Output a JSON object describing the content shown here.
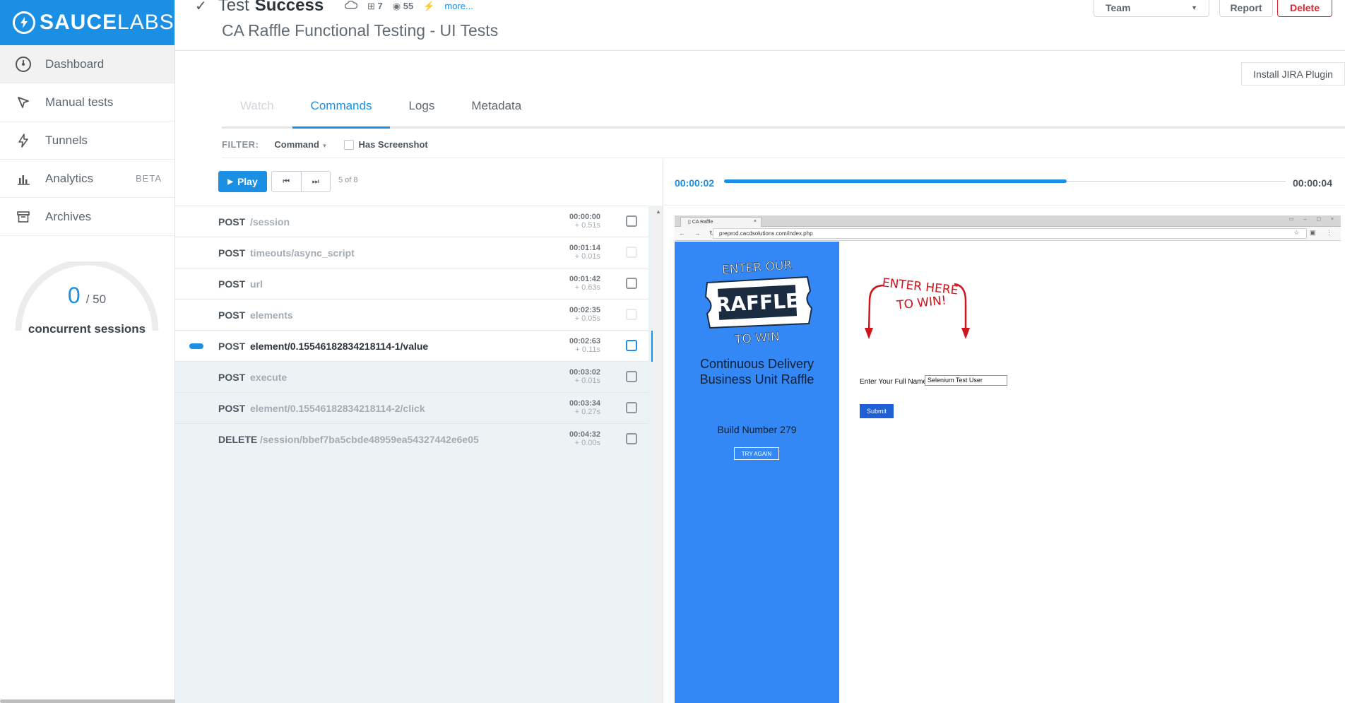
{
  "brand": {
    "name_bold": "SAUCE",
    "name_light": "LABS"
  },
  "sidebar": {
    "items": [
      {
        "label": "Dashboard",
        "icon": "gauge-icon"
      },
      {
        "label": "Manual tests",
        "icon": "cursor-icon"
      },
      {
        "label": "Tunnels",
        "icon": "bolt-icon"
      },
      {
        "label": "Analytics",
        "icon": "bar-chart-icon",
        "badge": "BETA"
      },
      {
        "label": "Archives",
        "icon": "archive-icon"
      }
    ],
    "sessions": {
      "current": "0",
      "max": "/ 50",
      "label": "concurrent sessions"
    }
  },
  "header": {
    "status_prefix": "Test",
    "status_word": "Success",
    "windows_version": "7",
    "chrome_version": "55",
    "more": "more...",
    "subtitle": "CA Raffle Functional Testing - UI Tests",
    "team_label": "Team",
    "report_label": "Report",
    "delete_label": "Delete"
  },
  "jira_button": "Install JIRA Plugin",
  "tabs": [
    {
      "label": "Watch",
      "state": "disabled"
    },
    {
      "label": "Commands",
      "state": "active"
    },
    {
      "label": "Logs",
      "state": "normal"
    },
    {
      "label": "Metadata",
      "state": "normal"
    }
  ],
  "filter": {
    "label": "FILTER:",
    "command": "Command",
    "screenshot_label": "Has Screenshot"
  },
  "player": {
    "play_label": "Play",
    "position": "5 of 8",
    "current_time": "00:00:02",
    "end_time": "00:00:04",
    "progress": 0.61
  },
  "commands": [
    {
      "method": "POST",
      "path": "/session",
      "time": "00:00:00",
      "delta": "+ 0.51s",
      "shot": true
    },
    {
      "method": "POST",
      "path": "timeouts/async_script",
      "time": "00:01:14",
      "delta": "+ 0.01s",
      "shot": false
    },
    {
      "method": "POST",
      "path": "url",
      "time": "00:01:42",
      "delta": "+ 0.63s",
      "shot": true
    },
    {
      "method": "POST",
      "path": "elements",
      "time": "00:02:35",
      "delta": "+ 0.05s",
      "shot": false
    },
    {
      "method": "POST",
      "path": "element/0.15546182834218114-1/value",
      "time": "00:02:63",
      "delta": "+ 0.11s",
      "shot": true,
      "current": true
    },
    {
      "method": "POST",
      "path": "execute",
      "time": "00:03:02",
      "delta": "+ 0.01s",
      "shot": true
    },
    {
      "method": "POST",
      "path": "element/0.15546182834218114-2/click",
      "time": "00:03:34",
      "delta": "+ 0.27s",
      "shot": true
    },
    {
      "method": "DELETE",
      "path": "/session/bbef7ba5cbde48959ea54327442e6e05",
      "time": "00:04:32",
      "delta": "+ 0.00s",
      "shot": true
    }
  ],
  "browser": {
    "tab_title": "CA Raffle",
    "url": "preprod.cacdsolutions.com/index.php",
    "page": {
      "ticket_top": "ENTER OUR",
      "ticket_main": "RAFFLE",
      "ticket_bottom": "TO WIN",
      "handwritten_1": "ENTER HERE",
      "handwritten_2": "TO WIN!",
      "title": "Continuous Delivery Business Unit Raffle",
      "build": "Build Number 279",
      "try_again": "TRY AGAIN",
      "name_label": "Enter Your Full Name:",
      "name_value": "Selenium Test User",
      "submit": "Submit"
    }
  },
  "colors": {
    "brand_blue": "#1a8fe3",
    "delete_red": "#e0242f",
    "page_blue": "#3388f5",
    "arrow_red": "#d0141c"
  }
}
